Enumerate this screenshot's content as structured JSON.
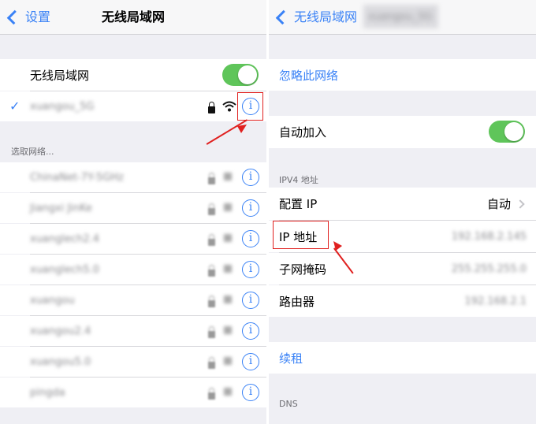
{
  "left": {
    "back_label": "设置",
    "title": "无线局域网",
    "wifi_toggle_label": "无线局域网",
    "connected_network": "xuangou_5G",
    "section_header": "选取网络...",
    "networks": [
      "ChinaNet-7Y-5GHz",
      "Jiangxi JinKe",
      "xuanglech2.4",
      "xuanglech5.0",
      "xuangou",
      "xuangou2.4",
      "xuangou5.0",
      "pingda"
    ],
    "info_glyph": "i"
  },
  "right": {
    "back_label": "无线局域网",
    "title_blurred": "xuangou_5G",
    "forget_network": "忽略此网络",
    "auto_join_label": "自动加入",
    "ipv4_header": "IPV4 地址",
    "configure_ip_label": "配置 IP",
    "configure_ip_value": "自动",
    "ip_address_label": "IP 地址",
    "ip_address_value": "192.168.2.145",
    "subnet_label": "子网掩码",
    "subnet_value": "255.255.255.0",
    "router_label": "路由器",
    "router_value": "192.168.2.1",
    "renew_lease": "续租",
    "dns_header": "DNS"
  },
  "colors": {
    "accent": "#3a82f6",
    "toggle_on": "#5fc55a",
    "highlight": "#e0201f"
  }
}
